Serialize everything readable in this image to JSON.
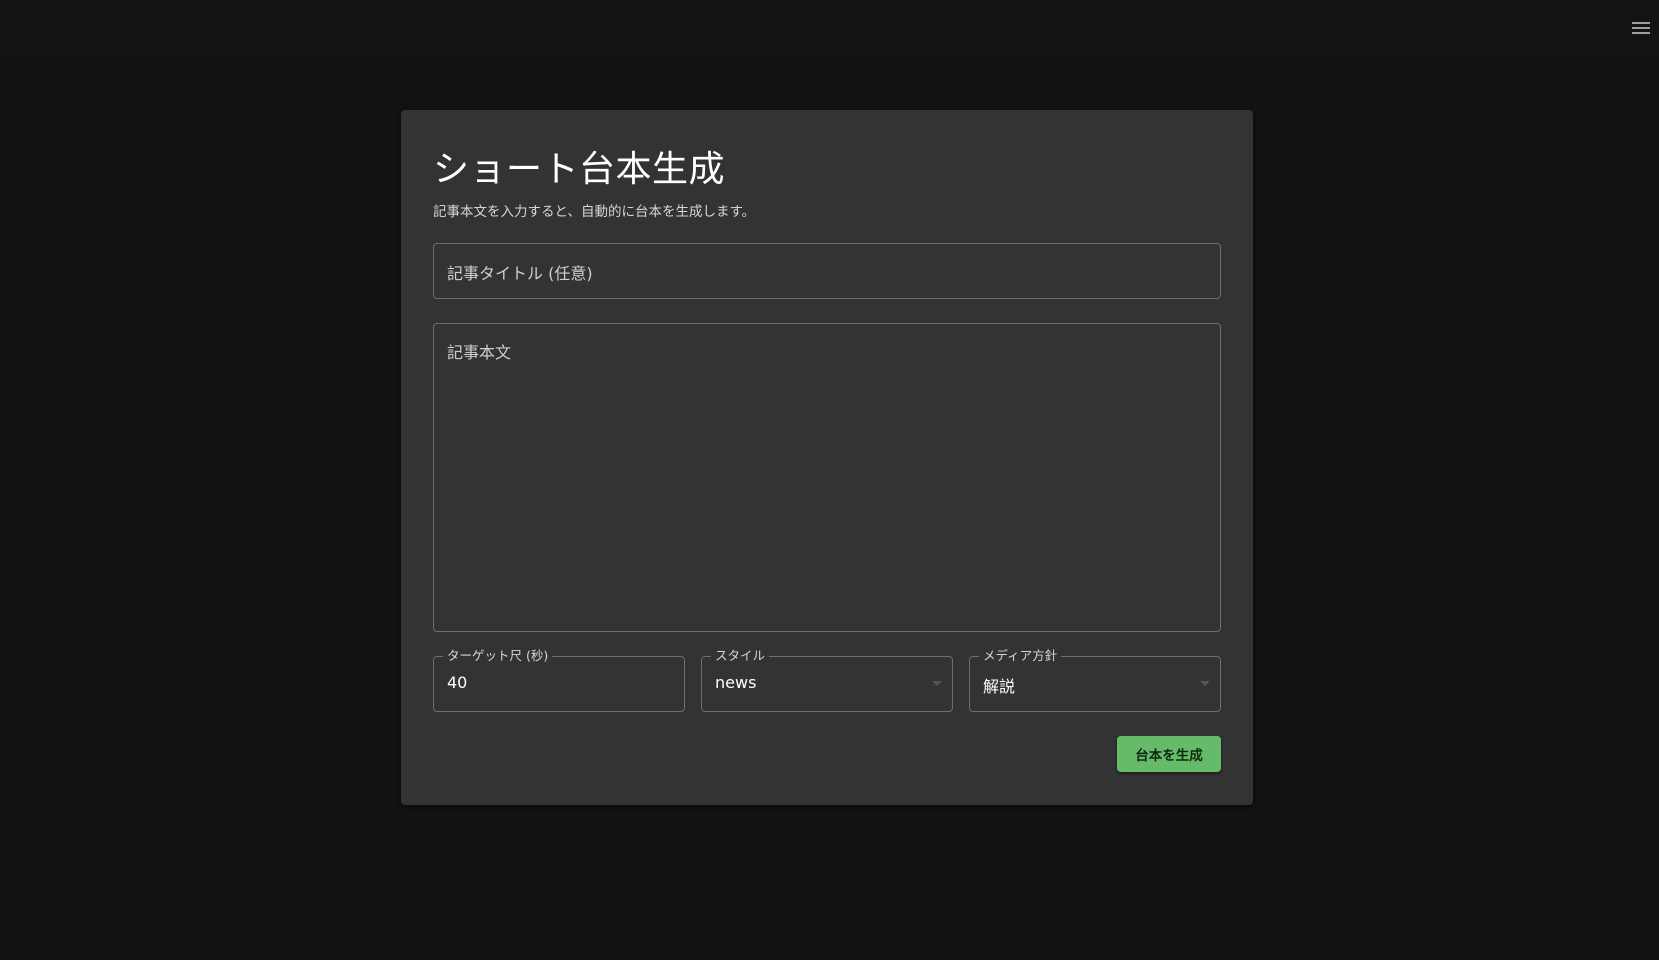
{
  "header": {
    "menu_icon": "hamburger-menu-icon"
  },
  "form": {
    "title": "ショート台本生成",
    "subtitle": "記事本文を入力すると、自動的に台本を生成します。",
    "article_title": {
      "placeholder": "記事タイトル (任意)",
      "value": ""
    },
    "article_body": {
      "placeholder": "記事本文",
      "value": ""
    },
    "target_duration": {
      "label": "ターゲット尺 (秒)",
      "value": "40"
    },
    "style": {
      "label": "スタイル",
      "value": "news"
    },
    "media_policy": {
      "label": "メディア方針",
      "value": "解説"
    },
    "generate_label": "台本を生成"
  },
  "colors": {
    "background": "#121212",
    "card": "#333333",
    "accent": "#66bb6a"
  }
}
